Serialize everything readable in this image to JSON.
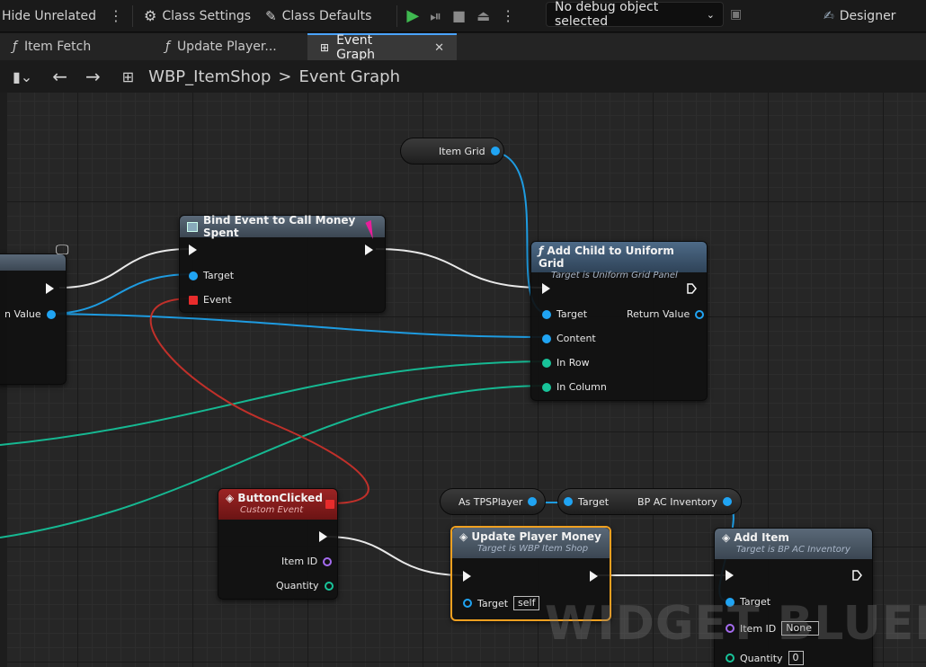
{
  "toolbar": {
    "hide_unrelated": "Hide Unrelated",
    "class_settings": "Class Settings",
    "class_defaults": "Class Defaults",
    "debug_select": "No debug object selected",
    "designer": "Designer"
  },
  "tabs": [
    {
      "label": "Item Fetch",
      "icon": "function-icon"
    },
    {
      "label": "Update Player...",
      "icon": "function-icon"
    },
    {
      "label": "Event Graph",
      "icon": "graph-icon",
      "active": true
    }
  ],
  "breadcrumb": {
    "root": "WBP_ItemShop",
    "separator": ">",
    "current": "Event Graph"
  },
  "nodes": {
    "left_partial": {
      "pin": "n Value"
    },
    "bind_event": {
      "title": "Bind Event to Call Money Spent",
      "target": "Target",
      "event": "Event"
    },
    "item_grid": {
      "label": "Item Grid"
    },
    "add_child": {
      "title": "Add Child to Uniform Grid",
      "subtitle": "Target is Uniform Grid Panel",
      "target": "Target",
      "return_value": "Return Value",
      "content": "Content",
      "in_row": "In Row",
      "in_column": "In Column"
    },
    "button_clicked": {
      "title": "ButtonClicked",
      "subtitle": "Custom Event",
      "item_id": "Item ID",
      "quantity": "Quantity"
    },
    "as_tps": {
      "label": "As TPSPlayer"
    },
    "bp_ac": {
      "target": "Target",
      "output": "BP AC Inventory"
    },
    "update_money": {
      "title": "Update Player Money",
      "subtitle": "Target is WBP Item Shop",
      "target": "Target",
      "self": "self"
    },
    "add_item": {
      "title": "Add Item",
      "subtitle": "Target is BP AC Inventory",
      "target": "Target",
      "item_id": "Item ID",
      "item_id_value": "None",
      "quantity": "Quantity",
      "quantity_value": "0"
    }
  },
  "watermark": "WIDGET BLUEPR",
  "colors": {
    "exec": "#f4f4f4",
    "object": "#20a4f3",
    "int": "#18c49a",
    "delegate": "#e82c2c",
    "name": "#a56cf0",
    "selected": "#f0a020"
  }
}
